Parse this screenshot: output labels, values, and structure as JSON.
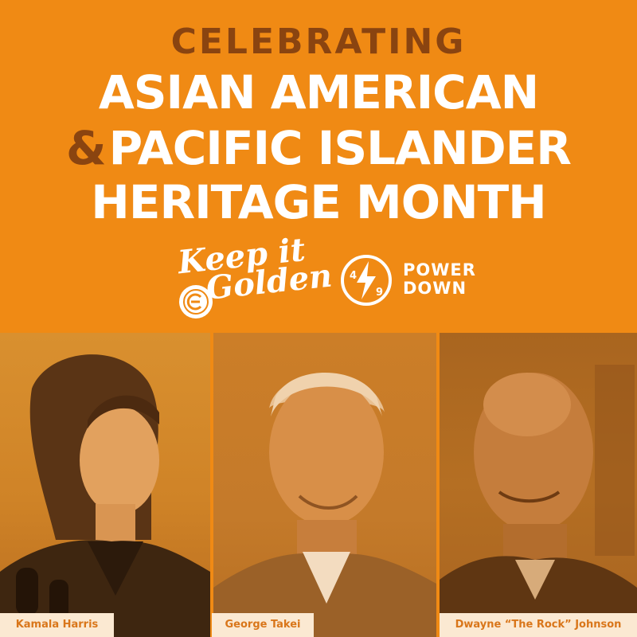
{
  "header": {
    "kicker": "CELEBRATING",
    "line1": "ASIAN AMERICAN",
    "ampersand": "&",
    "line2": "PACIFIC ISLANDER",
    "line3": "HERITAGE MONTH"
  },
  "logos": {
    "keep_it_golden": {
      "line1": "Keep it",
      "line2": "Golden",
      "seal_text": "ENERGY UPGRADE CALIFORNIA"
    },
    "power_down": {
      "line1": "POWER",
      "line2": "DOWN",
      "time_start": "4",
      "time_end": "9"
    }
  },
  "people": [
    {
      "name": "Kamala Harris"
    },
    {
      "name": "George Takei"
    },
    {
      "name": "Dwayne “The Rock” Johnson"
    }
  ],
  "colors": {
    "background": "#f08a14",
    "kicker": "#8a4410",
    "title": "#ffffff",
    "caption_bg": "#fbe9d2",
    "caption_text": "#d9761a"
  }
}
